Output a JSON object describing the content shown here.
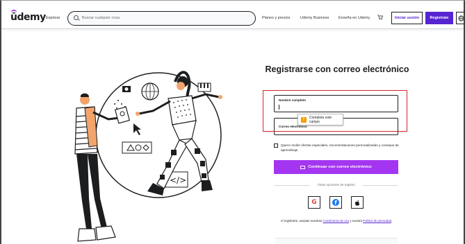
{
  "header": {
    "logo": "ūdemy",
    "explore_label": "Explorar",
    "search_placeholder": "Buscar cualquier cosa",
    "nav": [
      "Planes y precios",
      "Udemy Business",
      "Enseña en Udemy"
    ],
    "login_label": "Iniciar sesión",
    "register_label": "Registrate"
  },
  "form": {
    "title": "Registrarse con correo electrónico",
    "name_field": {
      "label": "Nombre completo",
      "value": ""
    },
    "email_field": {
      "label": "Correo electrónico",
      "value": ""
    },
    "validation_tooltip": "Completa este campo",
    "marketing_checkbox_label": "Quiero recibir ofertas especiales, recomendaciones personalizadas y consejos de aprendizaje.",
    "submit_label": "Continuar con correo electrónico",
    "other_options_label": "Otras opciones de registro",
    "social": [
      {
        "icon": "google-icon",
        "glyph": "G"
      },
      {
        "icon": "facebook-icon",
        "glyph": "f"
      },
      {
        "icon": "apple-icon",
        "glyph": ""
      }
    ],
    "terms": {
      "prefix": "Al registrarte, aceptas nuestras ",
      "terms_link": "Condiciones de uso",
      "middle": " y nuestra ",
      "privacy_link": "Política de privacidad",
      "suffix": "."
    }
  },
  "colors": {
    "brand_purple": "#a435f0",
    "dark_purple": "#5624d0",
    "highlight_red": "#d0242a",
    "warning_orange": "#f59b00"
  }
}
